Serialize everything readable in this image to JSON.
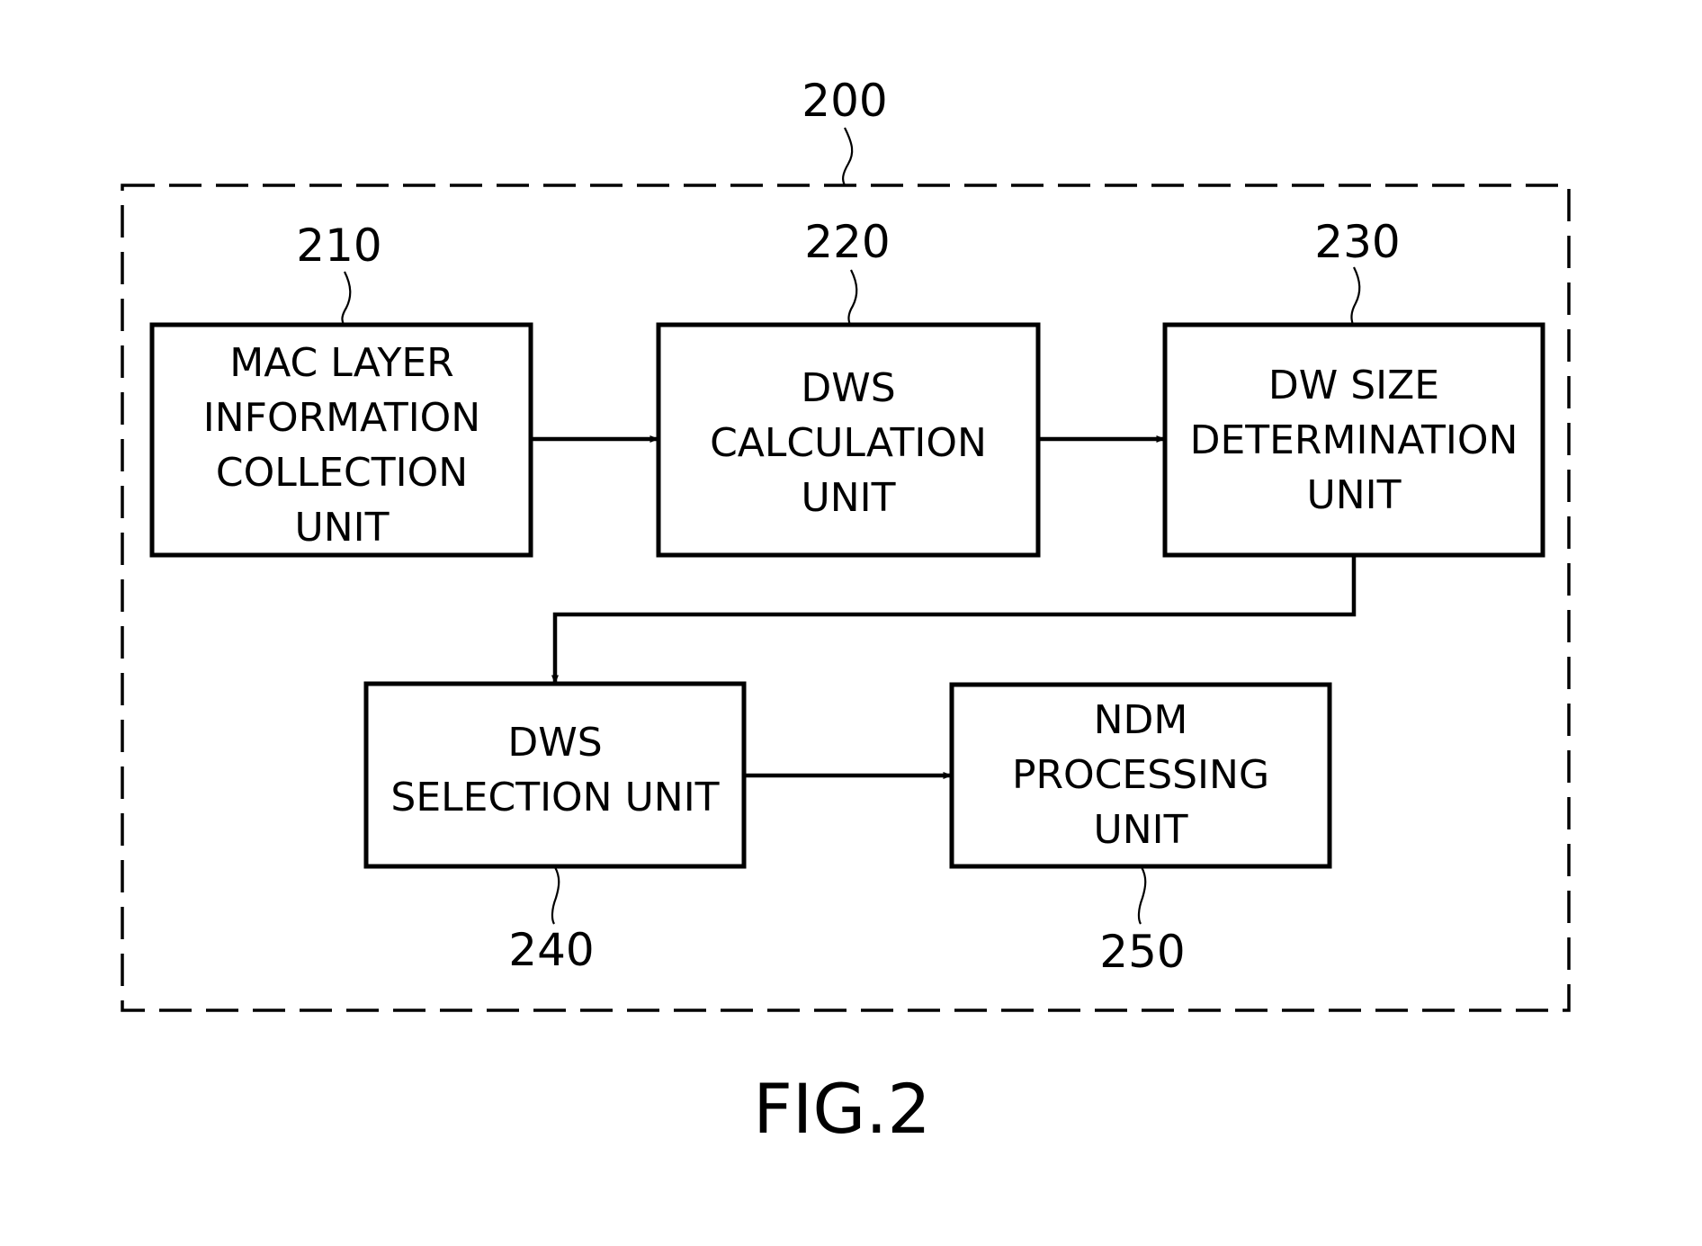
{
  "figure": {
    "caption": "FIG.2",
    "container": {
      "ref": "200"
    },
    "blocks": [
      {
        "ref": "210",
        "lines": [
          "MAC LAYER",
          "INFORMATION",
          "COLLECTION",
          "UNIT"
        ]
      },
      {
        "ref": "220",
        "lines": [
          "DWS",
          "CALCULATION",
          "UNIT"
        ]
      },
      {
        "ref": "230",
        "lines": [
          "DW SIZE",
          "DETERMINATION",
          "UNIT"
        ]
      },
      {
        "ref": "240",
        "lines": [
          "DWS",
          "SELECTION UNIT"
        ]
      },
      {
        "ref": "250",
        "lines": [
          "NDM",
          "PROCESSING",
          "UNIT"
        ]
      }
    ],
    "connections": [
      {
        "from": "210",
        "to": "220"
      },
      {
        "from": "220",
        "to": "230"
      },
      {
        "from": "230",
        "to": "240"
      },
      {
        "from": "240",
        "to": "250"
      }
    ]
  }
}
